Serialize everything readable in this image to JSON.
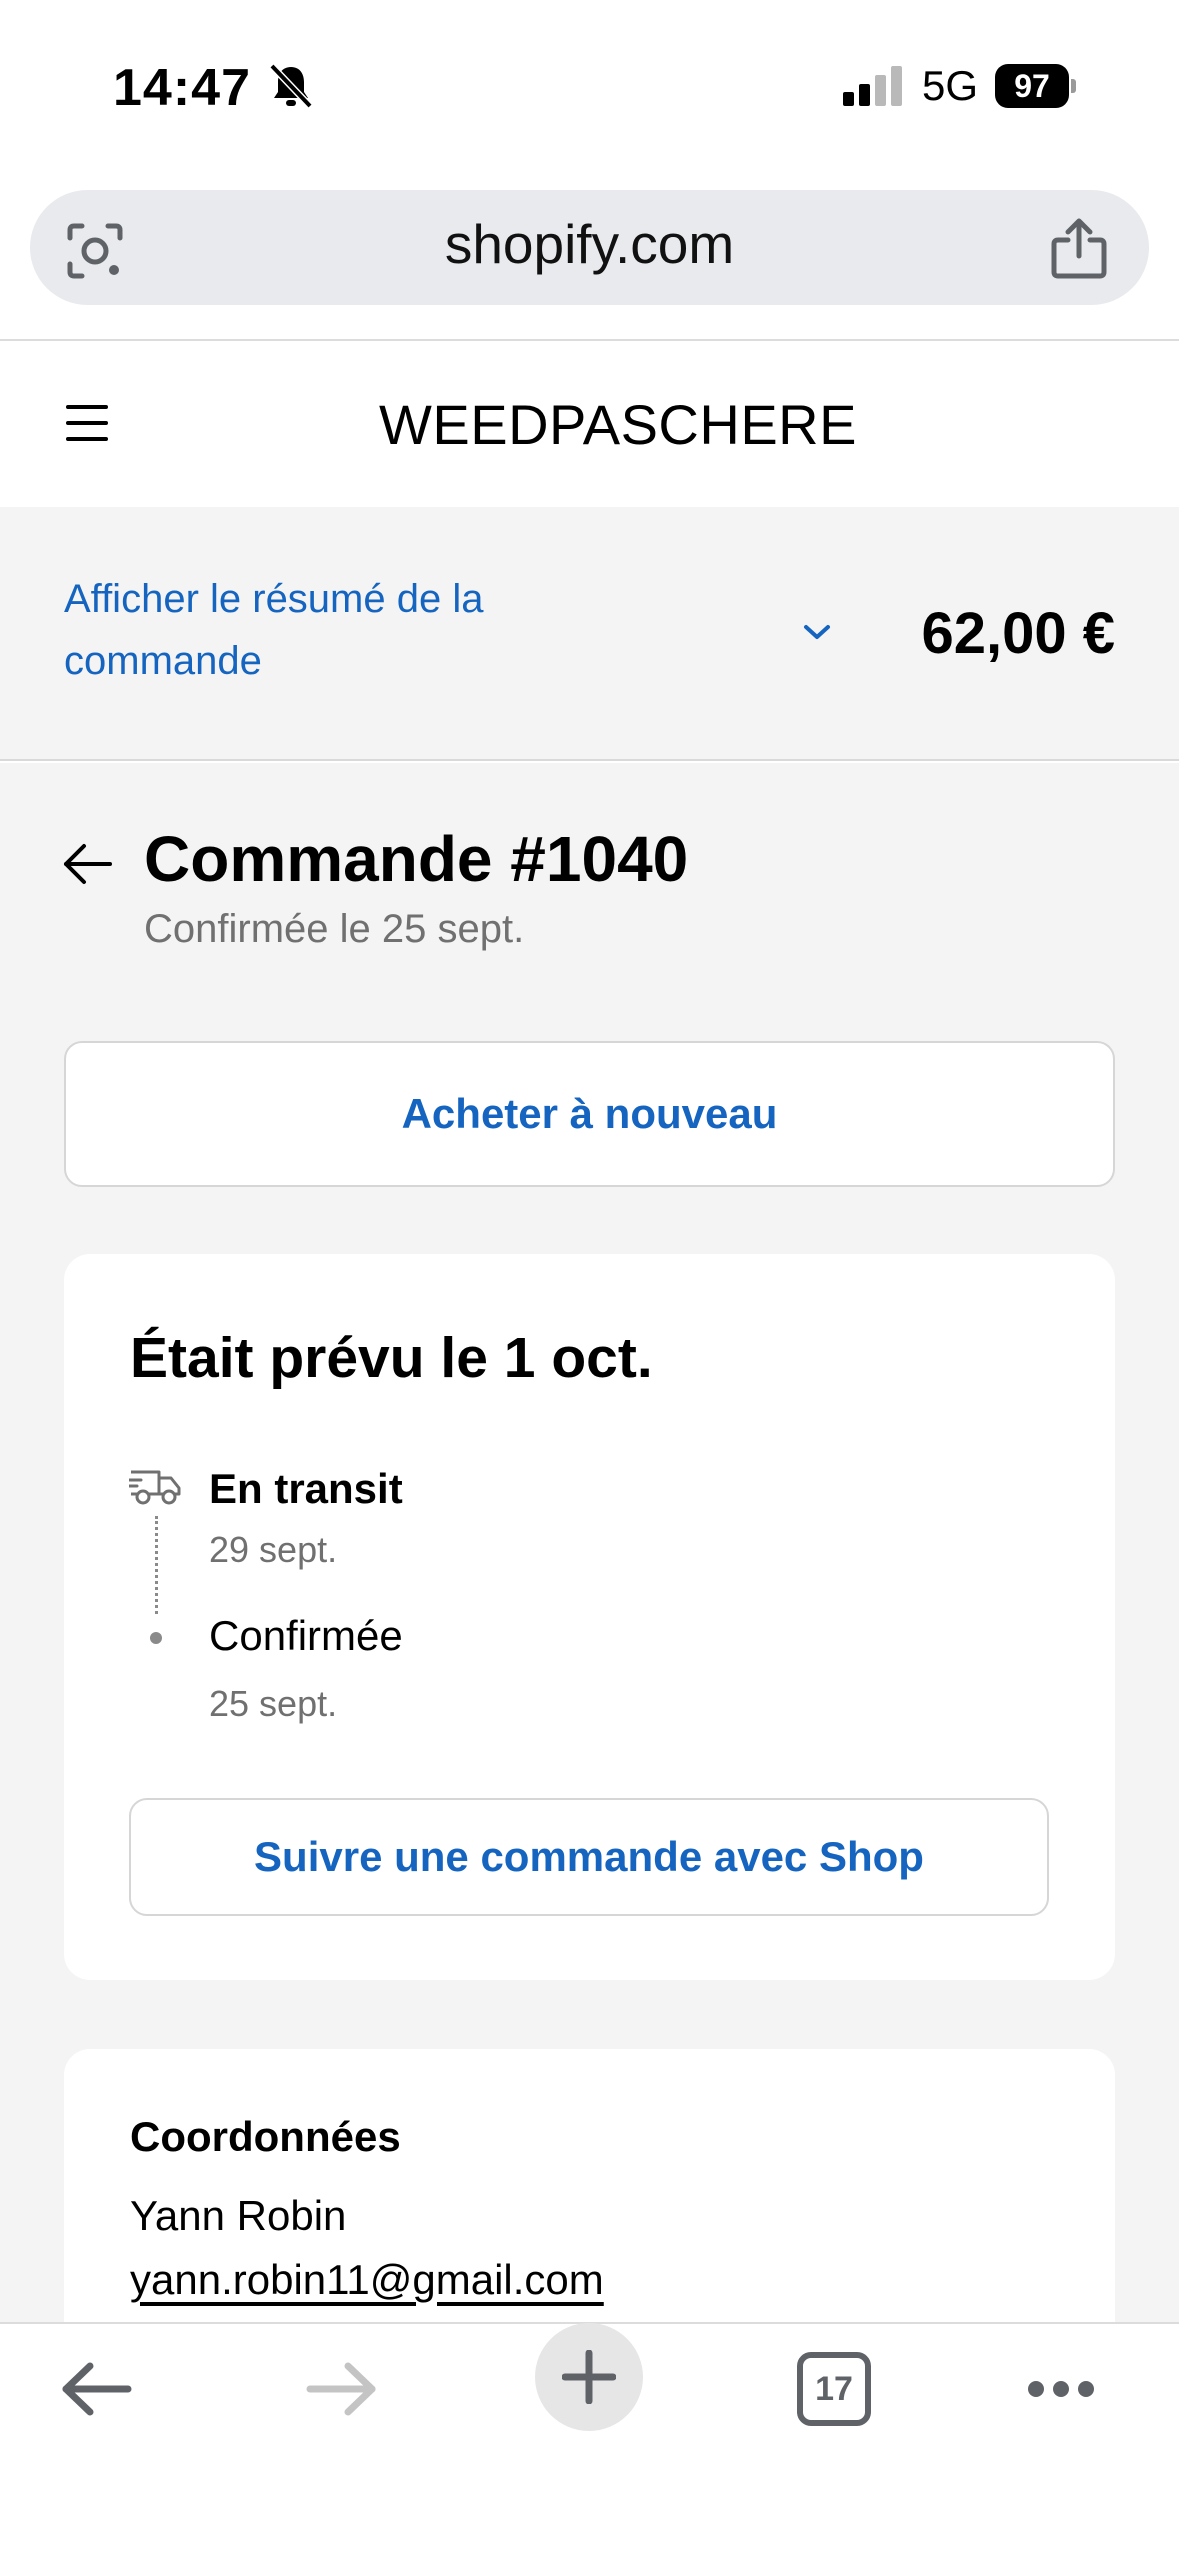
{
  "status_bar": {
    "time": "14:47",
    "network": "5G",
    "battery": "97",
    "icons": [
      "bell-muted-icon",
      "signal-icon",
      "battery-icon"
    ]
  },
  "browser": {
    "url": "shopify.com",
    "icons": [
      "lens-icon",
      "share-icon"
    ]
  },
  "store": {
    "name": "WEEDPASCHERE",
    "menu_icon": "hamburger-icon"
  },
  "summary": {
    "toggle_label": "Afficher le résumé de la commande",
    "total": "62,00 €"
  },
  "order": {
    "title": "Commande #1040",
    "subtitle": "Confirmée le 25 sept.",
    "buy_again": "Acheter à nouveau"
  },
  "shipping": {
    "title": "Était prévu le 1 oct.",
    "steps": [
      {
        "label": "En transit",
        "date": "29 sept.",
        "icon": "truck-icon"
      },
      {
        "label": "Confirmée",
        "date": "25 sept.",
        "icon": "dot-icon"
      }
    ],
    "track_button": "Suivre une commande avec Shop"
  },
  "contact": {
    "title": "Coordonnées",
    "name": "Yann Robin",
    "email": "yann.robin11@gmail.com"
  },
  "toolbar": {
    "tab_count": "17",
    "icons": [
      "back-arrow-icon",
      "forward-arrow-icon",
      "plus-icon",
      "tabs-icon",
      "more-icon"
    ]
  },
  "colors": {
    "accent": "#1565c0",
    "background": "#f4f4f4",
    "card": "#ffffff",
    "muted_text": "#707070"
  }
}
